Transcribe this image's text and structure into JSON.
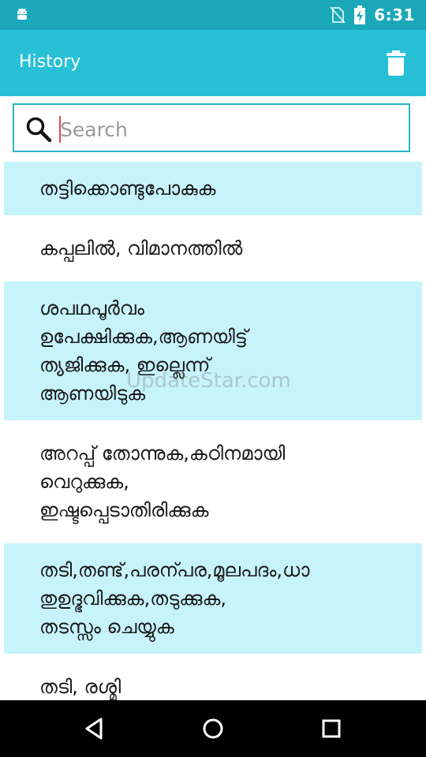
{
  "status_bar": {
    "time": "6:31",
    "icons": [
      "android-icon",
      "no-sim-icon",
      "battery-charging-icon"
    ]
  },
  "app_bar": {
    "title": "History",
    "action_icon": "trash-icon",
    "color": "#28c0d6"
  },
  "search": {
    "placeholder": "Search",
    "value": ""
  },
  "history": {
    "items": [
      "തട്ടിക്കൊണ്ടുപോകുക",
      "കപ്പലിൽ, വിമാനത്തിൽ",
      "ശപഥപൂർവം\nഉപേക്ഷിക്കുക,ആണയിട്ട്\nത്യജിക്കുക, ഇല്ലെന്ന്\nആണയിടുക",
      "അറപ്പ് തോന്നുക,കഠിനമായി\nവെറുക്കുക,\nഇഷ്ടപ്പെടാതിരിക്കുക",
      "തടി,തണ്ട്,പരന്പര,മൂലപദം,ധാ\nതുഉദ്ഭവിക്കുക,തടുക്കുക,\nതടസ്സം ചെയ്യുക",
      "തടി, രശ്മി"
    ]
  },
  "watermark": "UpdateStar.com",
  "nav_bar": {
    "icons": [
      "back-icon",
      "home-icon",
      "recents-icon"
    ]
  }
}
